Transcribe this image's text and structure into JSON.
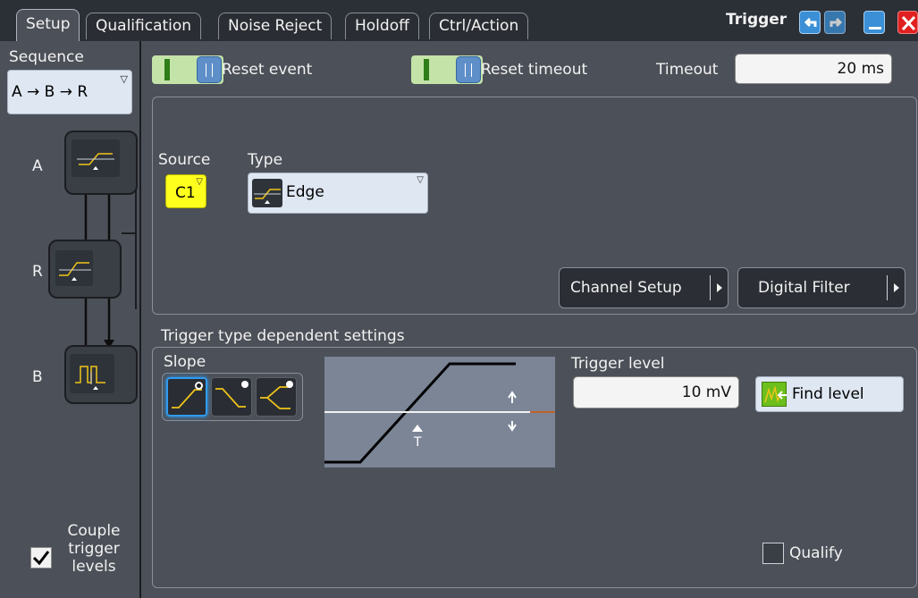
{
  "tabs": [
    {
      "label": "Setup",
      "active": true
    },
    {
      "label": "Qualification",
      "active": false
    },
    {
      "label": "Noise Reject",
      "active": false
    },
    {
      "label": "Holdoff",
      "active": false
    },
    {
      "label": "Ctrl/Action",
      "active": false
    }
  ],
  "window": {
    "title": "Trigger",
    "buttons": [
      "undo-icon",
      "redo-icon",
      "minimize-icon",
      "close-icon"
    ]
  },
  "sequence": {
    "label": "Sequence",
    "value": "A → B → R",
    "steps": [
      {
        "label": "A",
        "icon": "edge-trigger-icon"
      },
      {
        "label": "R",
        "icon": "edge-trigger-icon"
      },
      {
        "label": "B",
        "icon": "pulse-trigger-icon"
      }
    ],
    "couple_label_line1": "Couple",
    "couple_label_line2": "trigger",
    "couple_label_line3": "levels",
    "couple_checked": true
  },
  "top": {
    "reset_event_label": "Reset event",
    "reset_event_on": true,
    "reset_timeout_label": "Reset timeout",
    "reset_timeout_on": true,
    "timeout_label": "Timeout",
    "timeout_value": "20 ms"
  },
  "event": {
    "source_label": "Source",
    "source_value": "C1",
    "type_label": "Type",
    "type_value": "Edge",
    "channel_setup_label": "Channel Setup",
    "digital_filter_label": "Digital Filter"
  },
  "settings": {
    "section_title": "Trigger type dependent settings",
    "slope_label": "Slope",
    "slopes": [
      "rising-slope-icon",
      "falling-slope-icon",
      "either-slope-icon"
    ],
    "selected_slope": "rising",
    "preview_marker": "T",
    "trigger_level_label": "Trigger level",
    "trigger_level_value": "10 mV",
    "find_level_label": "Find level",
    "qualify_label": "Qualify",
    "qualify_checked": false
  },
  "colors": {
    "accent": "#2f9bf0",
    "channel1": "#ffff1e",
    "toggle_on": "#c4e3a8",
    "preview_bg": "#7b8596",
    "close": "#e02020"
  }
}
